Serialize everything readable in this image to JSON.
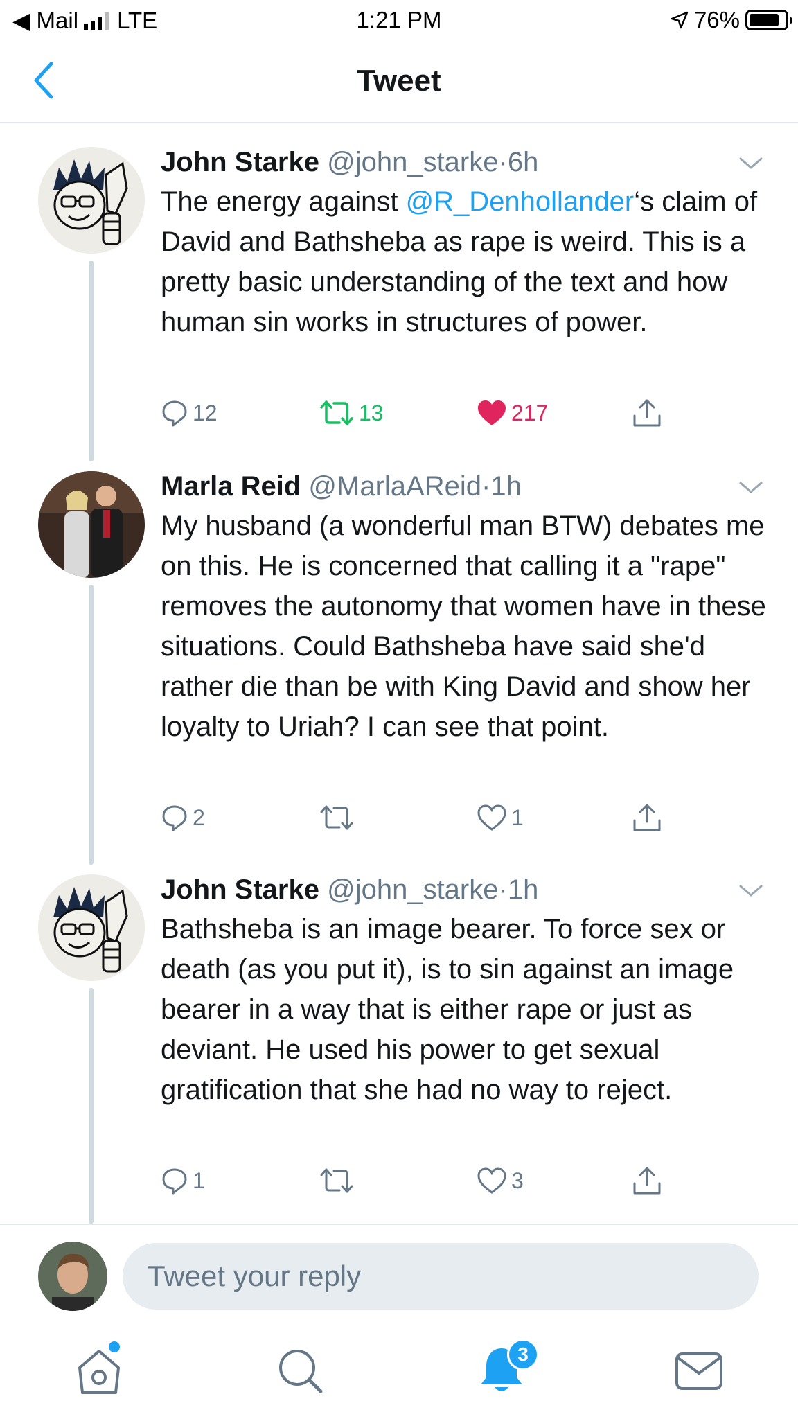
{
  "status_bar": {
    "carrier": "◀ Mail",
    "network": "LTE",
    "time": "1:21 PM",
    "battery": "76%"
  },
  "nav": {
    "title": "Tweet"
  },
  "tweets": [
    {
      "name": "John Starke",
      "handle": "@john_starke",
      "separator": "·",
      "time": "6h",
      "text_before": "The energy against ",
      "mention": "@R_Denhollander",
      "text_after": "‘s claim of David and Bathsheba as rape is weird. This is a pretty basic understanding of the text and how human sin works in structures of power.",
      "replies": "12",
      "retweets": "13",
      "likes": "217",
      "retweeted": true,
      "liked": true
    },
    {
      "name": "Marla Reid",
      "handle": "@MarlaAReid",
      "separator": "·",
      "time": "1h",
      "text": "My husband (a wonderful man BTW) debates me on this.  He is concerned that calling it a \"rape\" removes the autonomy that women have in these situations.  Could Bathsheba have said she'd rather die than be with King David and show her loyalty to Uriah?  I can see that point.",
      "replies": "2",
      "retweets": "",
      "likes": "1",
      "retweeted": false,
      "liked": false
    },
    {
      "name": "John Starke",
      "handle": "@john_starke",
      "separator": "·",
      "time": "1h",
      "text": "Bathsheba is an image bearer. To force sex or death (as you put it), is to sin against an image bearer in a way that is either rape or just as deviant. He used his power to get sexual gratification that she had no way to reject.",
      "replies": "1",
      "retweets": "",
      "likes": "3",
      "retweeted": false,
      "liked": false
    }
  ],
  "reply": {
    "placeholder": "Tweet your reply"
  },
  "tabbar": {
    "notifications_badge": "3"
  },
  "colors": {
    "accent": "#1da1f2",
    "retweet": "#17bf63",
    "like": "#e0245e",
    "muted": "#657786"
  }
}
